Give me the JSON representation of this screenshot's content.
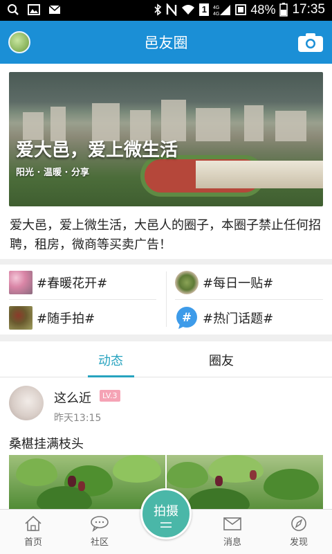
{
  "status_bar": {
    "battery_percent": "48%",
    "time": "17:35",
    "left_icons": [
      "search-icon",
      "image-icon",
      "mail-icon"
    ],
    "right_icons": [
      "bluetooth-icon",
      "nfc-icon",
      "wifi-icon",
      "sim-icon",
      "signal-icon",
      "data-saver-icon",
      "battery-icon"
    ],
    "sim_label": "1"
  },
  "header": {
    "title": "邑友圈",
    "left_icon": "avatar",
    "right_icon": "camera-icon",
    "color": "#1b8fd6"
  },
  "banner": {
    "headline": "爱大邑，爱上微生活",
    "subline": "阳光 · 温暖 · 分享"
  },
  "description": "爱大邑，爱上微生活，大邑人的圈子，本圈子禁止任何招聘，租房，微商等买卖广告！",
  "topics": [
    {
      "label": "#春暖花开#",
      "thumb": "flowers"
    },
    {
      "label": "#每日一贴#",
      "thumb": "food"
    },
    {
      "label": "#随手拍#",
      "thumb": "fruit"
    },
    {
      "label": "#热门话题#",
      "thumb": "hash-bubble-icon"
    }
  ],
  "tabs": [
    {
      "label": "动态",
      "active": true
    },
    {
      "label": "圈友",
      "active": false
    }
  ],
  "accent_color": "#27a3bf",
  "post": {
    "username": "这么近",
    "level": "LV.3",
    "time": "昨天13:15",
    "text": "桑椹挂满枝头"
  },
  "bottom_nav": {
    "items": [
      {
        "label": "首页",
        "icon": "home-icon"
      },
      {
        "label": "社区",
        "icon": "chat-bubble-icon"
      },
      {
        "label": "消息",
        "icon": "mail-icon"
      },
      {
        "label": "发现",
        "icon": "compass-icon"
      }
    ],
    "fab_label": "拍摄",
    "fab_color": "#4ab7a8"
  }
}
